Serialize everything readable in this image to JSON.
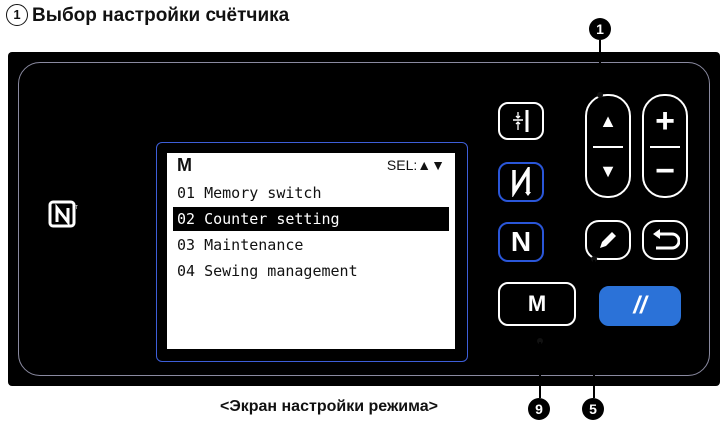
{
  "heading": {
    "number": "1",
    "text": "Выбор настройки счётчика"
  },
  "lcd": {
    "mode": "M",
    "sel_label": "SEL:▲▼",
    "items": [
      {
        "label": "01 Memory switch",
        "selected": false
      },
      {
        "label": "02 Counter setting",
        "selected": true
      },
      {
        "label": "03 Maintenance",
        "selected": false
      },
      {
        "label": "04 Sewing management",
        "selected": false
      }
    ]
  },
  "buttons": {
    "m_label": "M",
    "n_label": "N",
    "up_label": "▲",
    "down_label": "▼",
    "plus_label": "+",
    "minus_label": "−",
    "reset_label": "//"
  },
  "callouts": {
    "top": "1",
    "edit": "5",
    "m": "9"
  },
  "caption": "<Экран настройки режима>",
  "colors": {
    "panel": "#000000",
    "accent_blue": "#2b72d8",
    "lcd_frame": "#3d5ed8"
  }
}
